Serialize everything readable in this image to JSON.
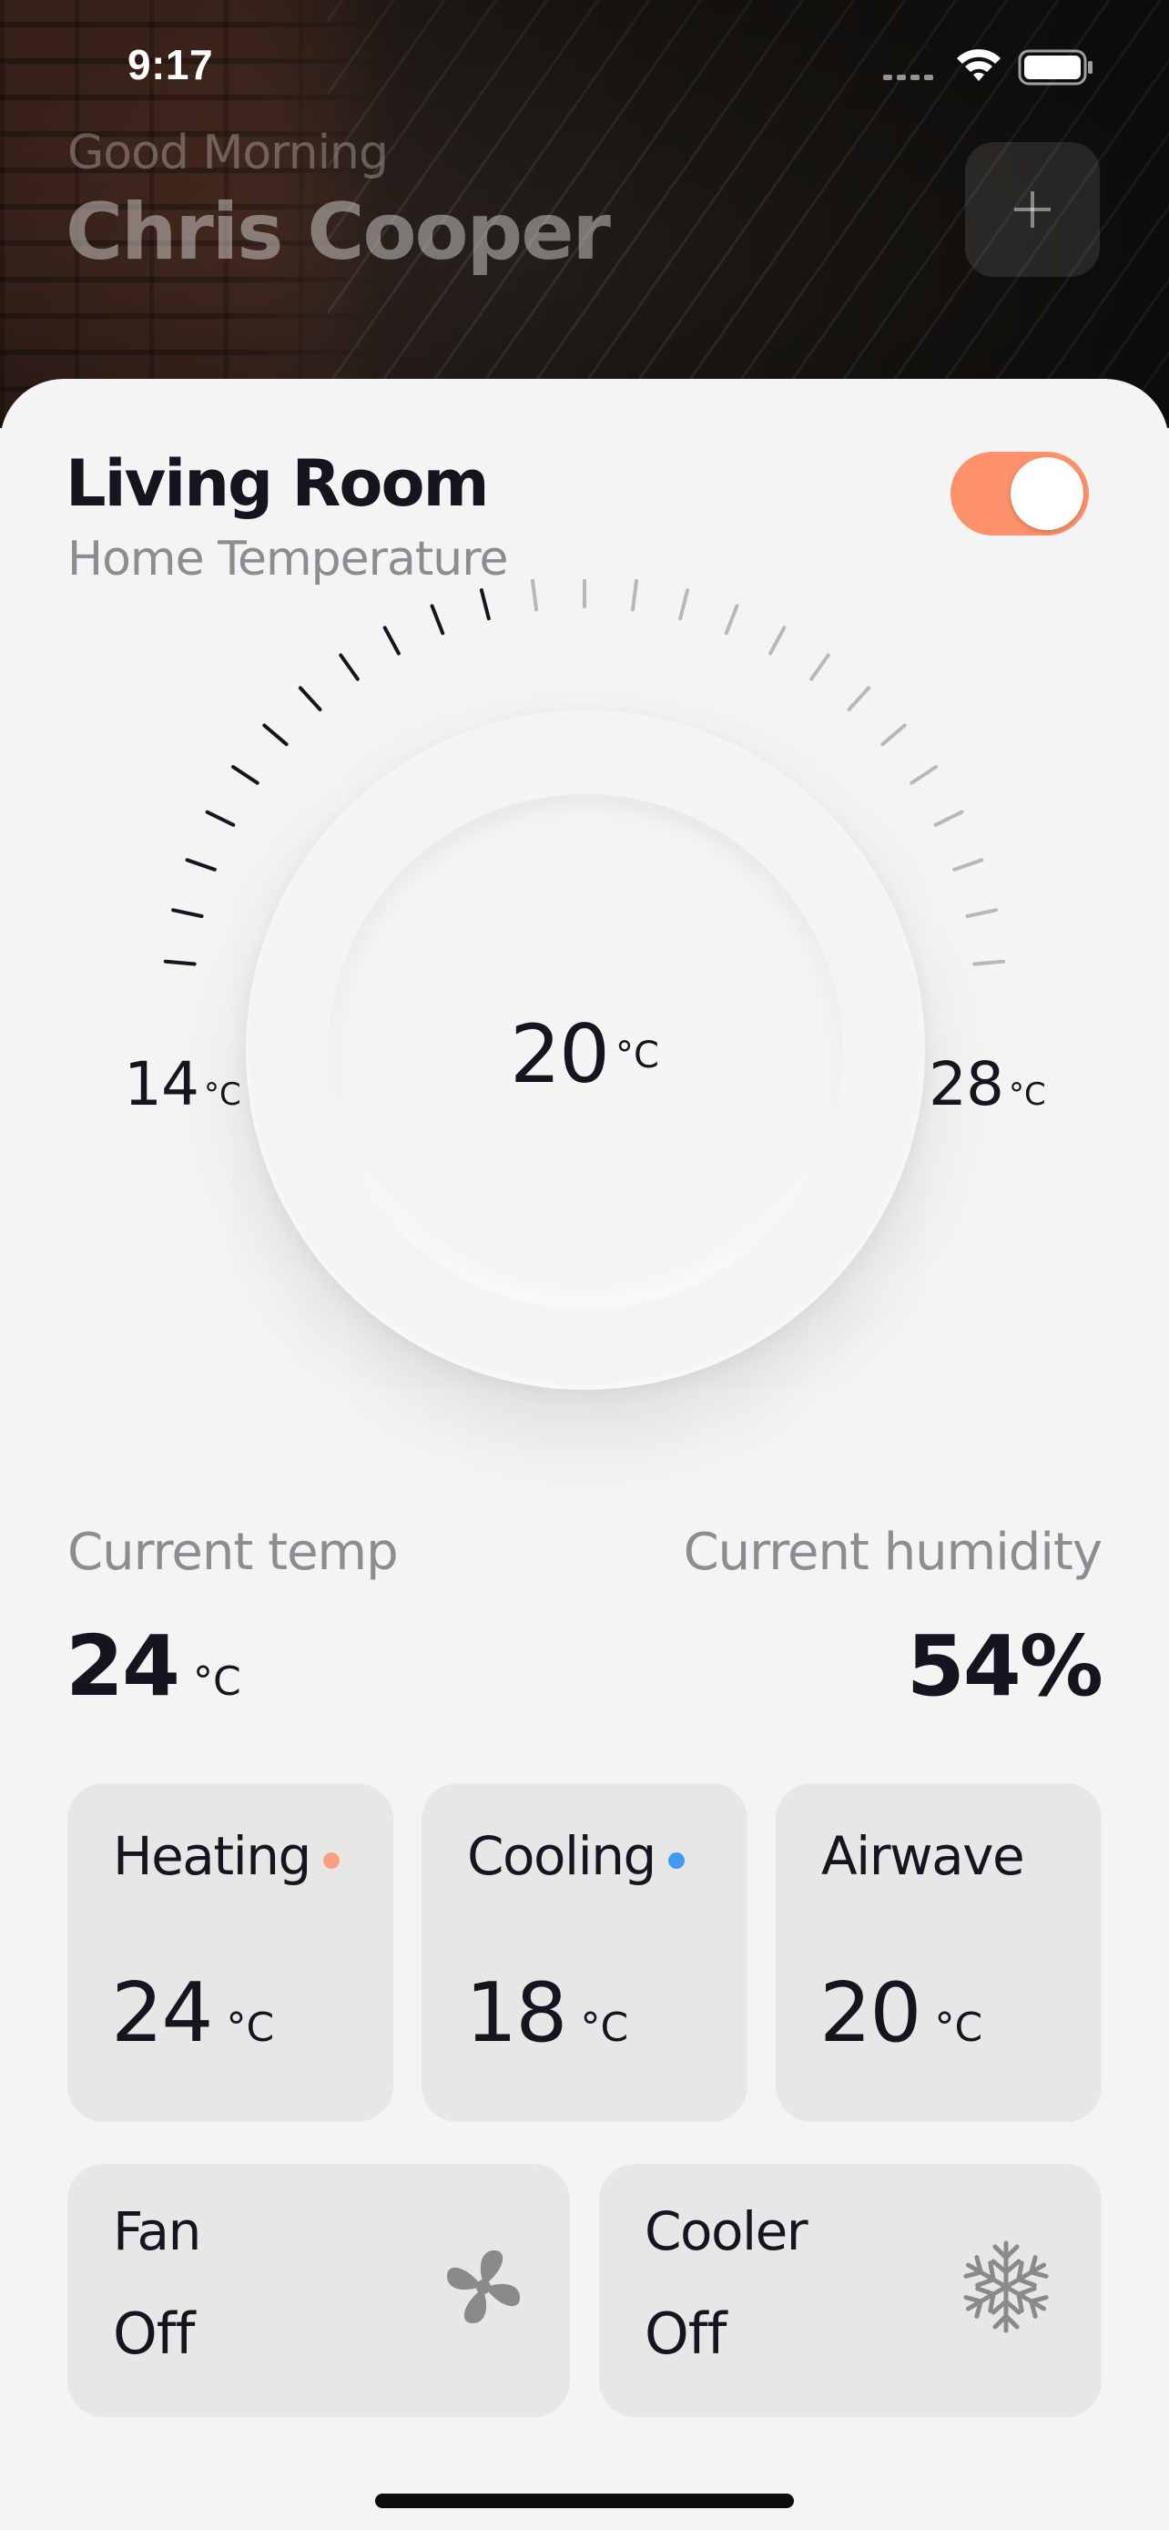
{
  "status_bar": {
    "time": "9:17"
  },
  "header": {
    "greeting": "Good Morning",
    "user_name": "Chris Cooper",
    "add_label": "+"
  },
  "room": {
    "title": "Living Room",
    "subtitle": "Home Temperature",
    "power_on": true
  },
  "dial": {
    "value": "20",
    "unit": "°C",
    "min": "14",
    "max": "28",
    "min_unit": "°C",
    "max_unit": "°C",
    "level_fraction": 0.43
  },
  "stats": {
    "temp_label": "Current temp",
    "temp_value": "24",
    "temp_unit": "°C",
    "humidity_label": "Current humidity",
    "humidity_value": "54%"
  },
  "modes": [
    {
      "label": "Heating",
      "value": "24",
      "unit": "°C",
      "dot_color": "#f9a07e"
    },
    {
      "label": "Cooling",
      "value": "18",
      "unit": "°C",
      "dot_color": "#3f9bef"
    },
    {
      "label": "Airwave",
      "value": "20",
      "unit": "°C"
    }
  ],
  "devices": [
    {
      "label": "Fan",
      "state": "Off",
      "icon": "fan-icon"
    },
    {
      "label": "Cooler",
      "state": "Off",
      "icon": "snowflake-icon"
    }
  ],
  "colors": {
    "accent": "#fd926a",
    "text": "#15151f",
    "muted": "#8c8c92",
    "tile_bg": "#e7e7e7"
  }
}
